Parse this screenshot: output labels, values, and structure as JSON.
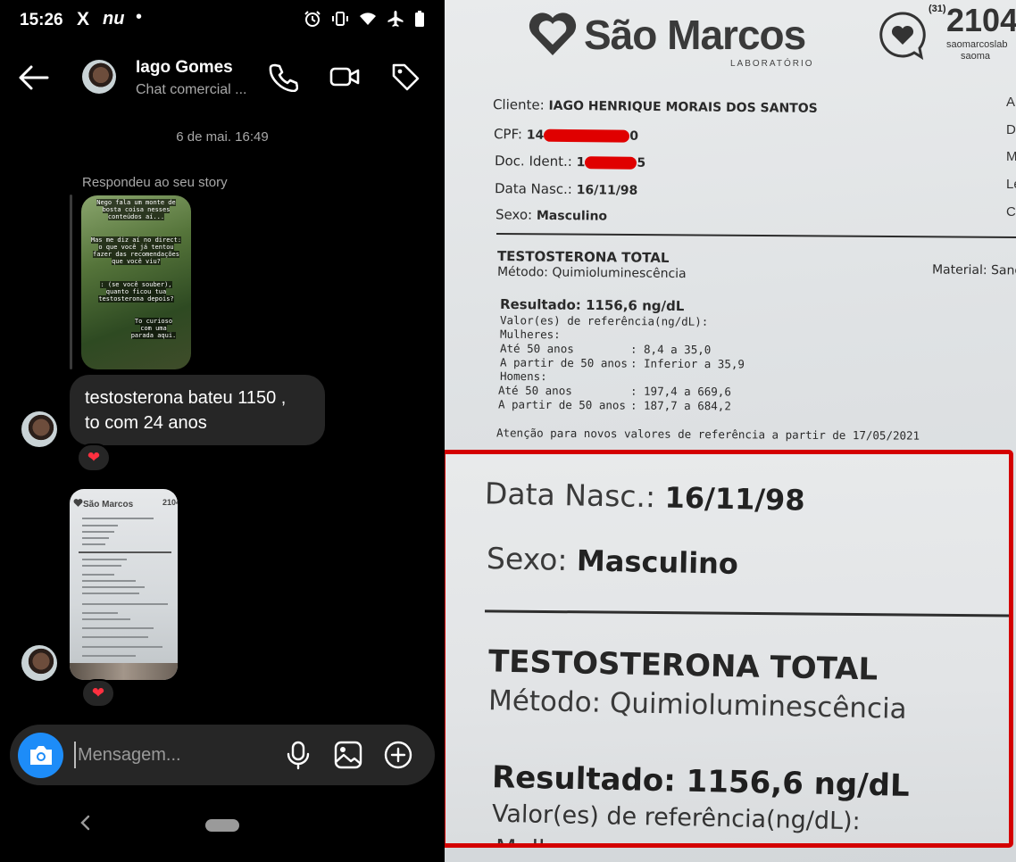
{
  "status_bar": {
    "time": "15:26",
    "app_glyphs": [
      "X",
      "nu",
      "•"
    ],
    "icons": [
      "alarm-icon",
      "vibrate-icon",
      "wifi-icon",
      "airplane-icon",
      "battery-icon"
    ]
  },
  "chat": {
    "contact_name": "Iago Gomes",
    "contact_subtitle": "Chat comercial ...",
    "header_actions": [
      "phone-icon",
      "video-icon",
      "tag-icon"
    ],
    "date_separator": "6 de mai. 16:49",
    "story_reply_label": "Respondeu ao seu story",
    "story_lines": [
      "Nego fala um monte de",
      "bosta coisa nesses",
      "conteúdos aí...",
      "Mas me diz aí no direct:",
      "o que você já tentou",
      "fazer das recomendações",
      "que você viu?",
      ": (se você souber),",
      "quanto ficou tua",
      "testosterona depois?",
      "To curioso",
      "com uma",
      "parada aqui."
    ],
    "message_lines": [
      "testosterona bateu 1150 ,",
      "to com 24 anos"
    ],
    "reaction_emoji": "❤",
    "composer_placeholder": "Mensagem..."
  },
  "document": {
    "lab_name": "São Marcos",
    "lab_subtitle": "LABORATÓRIO",
    "phone_code": "(31)",
    "phone_number": "2104",
    "site": "saomarcoslab",
    "social": "saoma",
    "cliente_label": "Cliente:",
    "cliente_value": "IAGO HENRIQUE MORAIS DOS SANTOS",
    "cpf_label": "CPF:",
    "cpf_prefix": "14",
    "cpf_suffix": "0",
    "doc_label": "Doc. Ident.:",
    "doc_prefix": "1",
    "doc_suffix": "5",
    "nasc_label": "Data Nasc.:",
    "nasc_value": "16/11/98",
    "sexo_label": "Sexo:",
    "sexo_value": "Masculino",
    "edge_letters": [
      "A",
      "D",
      "M",
      "Le",
      "C"
    ],
    "exam_title": "TESTOSTERONA TOTAL",
    "method": "Método: Quimioluminescência",
    "material": "Material: Sang",
    "result": "Resultado: 1156,6 ng/dL",
    "ref_header": "Valor(es) de referência(ng/dL):",
    "women_label": "Mulheres:",
    "men_label": "Homens:",
    "ref_rows": [
      {
        "age": "Até 50 anos",
        "range": ": 8,4 a 35,0"
      },
      {
        "age": "A partir de 50 anos",
        "range": ": Inferior a 35,9"
      },
      {
        "age": "Até 50 anos",
        "range": ": 197,4 a 669,6"
      },
      {
        "age": "A partir de 50 anos",
        "range": ": 187,7 a 684,2"
      }
    ],
    "notice": "Atenção para novos valores de referência a partir de 17/05/2021",
    "zoom": {
      "nasc_label": "Data Nasc.:",
      "nasc_value": "16/11/98",
      "sexo_label": "Sexo:",
      "sexo_value": "Masculino",
      "exam_title": "TESTOSTERONA TOTAL",
      "method": "Método: Quimioluminescência",
      "result": "Resultado: 1156,6 ng/dL",
      "ref_header": "Valor(es) de referência(ng/dL):",
      "cut_text": "Mulheres:"
    },
    "highlight_color": "#d40000",
    "redaction_color": "#e00000"
  }
}
